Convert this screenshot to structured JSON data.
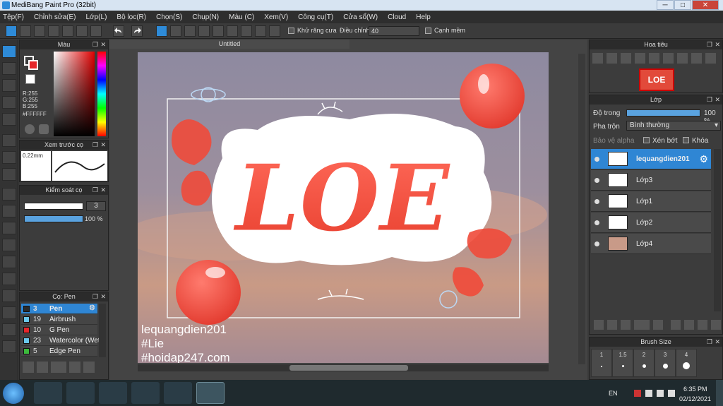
{
  "window": {
    "title": "MediBang Paint Pro (32bit)",
    "controls": [
      "─",
      "□",
      "✕"
    ]
  },
  "menu": [
    "Tệp(F)",
    "Chỉnh sửa(E)",
    "Lớp(L)",
    "Bộ lọc(R)",
    "Chọn(S)",
    "Chụp(N)",
    "Màu (C)",
    "Xem(V)",
    "Công cụ(T)",
    "Cửa sổ(W)",
    "Cloud",
    "Help"
  ],
  "toolbar": {
    "antialias_label": "Khử răng cưa",
    "adjust_label": "Điều chỉnh",
    "adjust_value": "40",
    "snap_label": "Cạnh mềm"
  },
  "color_panel": {
    "title": "Màu",
    "r": "R:255",
    "g": "G:255",
    "b": "B:255",
    "hex": "#FFFFFF",
    "primary_color": "#e5262a",
    "secondary_color": "#ffffff"
  },
  "preview_panel": {
    "title": "Xem trước cọ",
    "size": "0.22mm"
  },
  "brush_control": {
    "title": "Kiểm soát cọ",
    "size_value": "3",
    "opacity_value": "100 %"
  },
  "brush_list": {
    "title": "Cọ: Pen",
    "items": [
      {
        "size": "3",
        "name": "Pen",
        "color": "#2b2b2b"
      },
      {
        "size": "19",
        "name": "Airbrush",
        "color": "#69c7ec"
      },
      {
        "size": "10",
        "name": "G Pen",
        "color": "#e5262a"
      },
      {
        "size": "23",
        "name": "Watercolor (Wet)",
        "color": "#69c7ec"
      },
      {
        "size": "5",
        "name": "Edge Pen",
        "color": "#3cba3c"
      }
    ]
  },
  "document": {
    "tab": "Untitled",
    "artwork_title": "LOE",
    "credit_lines": [
      "lequangdien201",
      "#Lie",
      "#hoidap247.com"
    ]
  },
  "navigator": {
    "title": "Hoa tiêu",
    "thumb_text": "LOE"
  },
  "layer_panel": {
    "title": "Lớp",
    "opacity_label": "Độ trong",
    "opacity_value": "100 %",
    "opacity_fraction": 1.0,
    "blend_label": "Pha trộn",
    "blend_value": "Bình thường",
    "protect_alpha": "Bảo vệ alpha",
    "clip": "Xén bớt",
    "lock": "Khóa",
    "layers": [
      {
        "name": "lequangdien201",
        "selected": true
      },
      {
        "name": "Lớp3",
        "selected": false
      },
      {
        "name": "Lớp1",
        "selected": false
      },
      {
        "name": "Lớp2",
        "selected": false
      },
      {
        "name": "Lớp4",
        "selected": false
      }
    ]
  },
  "brush_size_panel": {
    "title": "Brush Size",
    "sizes": [
      "1",
      "1.5",
      "2",
      "3",
      "4"
    ]
  },
  "taskbar": {
    "lang": "EN",
    "time": "6:35 PM",
    "date": "02/12/2021"
  }
}
